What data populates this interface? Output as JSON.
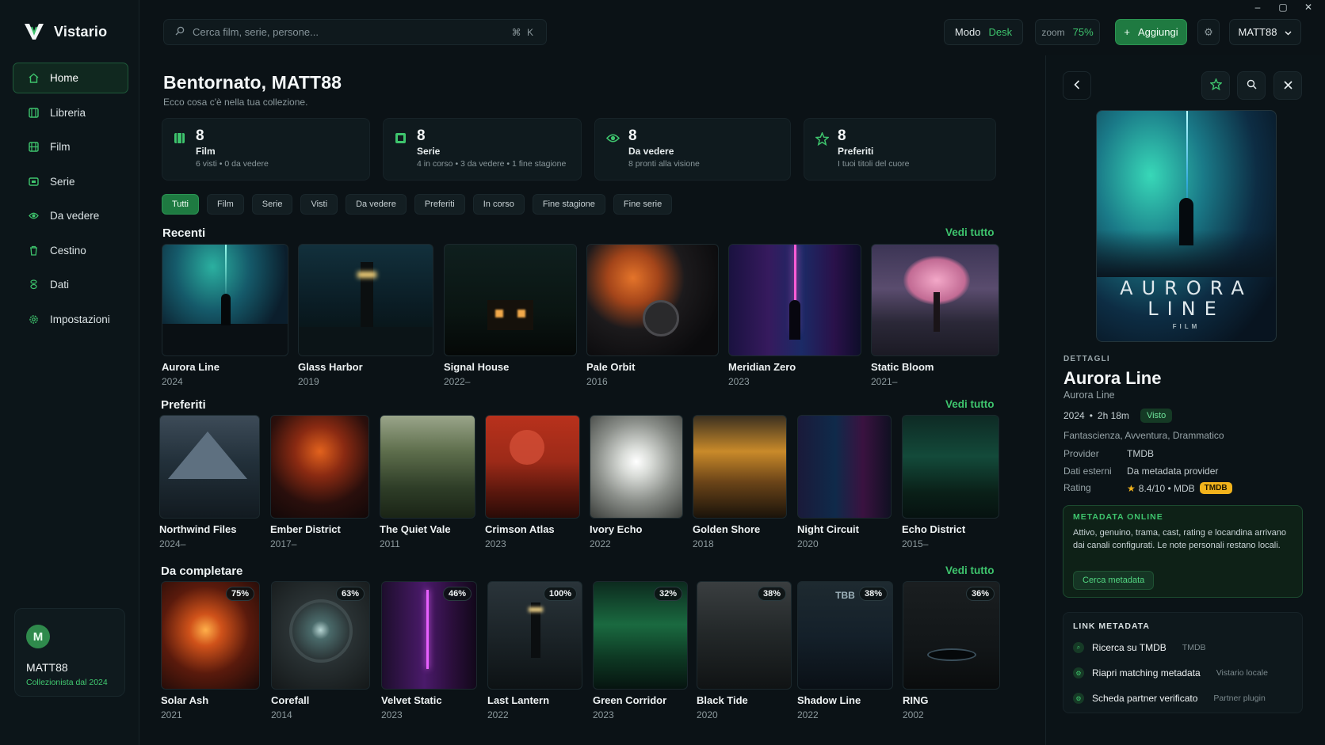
{
  "app": {
    "name": "Vistario"
  },
  "window": {
    "minimize": "–",
    "maximize": "▢",
    "close": "✕"
  },
  "sidebar": {
    "items": [
      {
        "label": "Home",
        "icon": "home-icon"
      },
      {
        "label": "Libreria",
        "icon": "library-icon"
      },
      {
        "label": "Film",
        "icon": "film-icon"
      },
      {
        "label": "Serie",
        "icon": "tv-icon"
      },
      {
        "label": "Da vedere",
        "icon": "eye-icon"
      },
      {
        "label": "Cestino",
        "icon": "trash-icon"
      },
      {
        "label": "Dati",
        "icon": "data-icon"
      },
      {
        "label": "Impostazioni",
        "icon": "gear-icon"
      }
    ],
    "active": "Home",
    "user": {
      "initial": "M",
      "name": "MATT88",
      "since": "Collezionista dal 2024"
    }
  },
  "topbar": {
    "search_placeholder": "Cerca film, serie, persone...",
    "search_shortcut": "⌘ K",
    "mode_label": "Modo",
    "mode_value": "Desk",
    "zoom_label": "zoom",
    "zoom_value": "75%",
    "add_label": "Aggiungi",
    "user_label": "MATT88"
  },
  "welcome": {
    "title": "Bentornato, MATT88",
    "subtitle": "Ecco cosa c'è nella tua collezione."
  },
  "stats": [
    {
      "num": "8",
      "label": "Film",
      "sub": "6 visti  •  0 da vedere",
      "icon": "film-icon"
    },
    {
      "num": "8",
      "label": "Serie",
      "sub": "4 in corso  •  3 da vedere  •  1 fine stagione",
      "icon": "tv-icon"
    },
    {
      "num": "8",
      "label": "Da vedere",
      "sub": "8 pronti alla visione",
      "icon": "eye-icon"
    },
    {
      "num": "8",
      "label": "Preferiti",
      "sub": "I tuoi titoli del cuore",
      "icon": "star-icon"
    }
  ],
  "filters": [
    "Tutti",
    "Film",
    "Serie",
    "Visti",
    "Da vedere",
    "Preferiti",
    "In corso",
    "Fine stagione",
    "Fine serie"
  ],
  "active_filter": "Tutti",
  "see_all": "Vedi tutto",
  "sections": {
    "recent": {
      "title": "Recenti",
      "items": [
        {
          "title": "Aurora Line",
          "year": "2024"
        },
        {
          "title": "Glass Harbor",
          "year": "2019"
        },
        {
          "title": "Signal House",
          "year": "2022–"
        },
        {
          "title": "Pale Orbit",
          "year": "2016"
        },
        {
          "title": "Meridian Zero",
          "year": "2023"
        },
        {
          "title": "Static Bloom",
          "year": "2021–"
        }
      ]
    },
    "favorites": {
      "title": "Preferiti",
      "items": [
        {
          "title": "Northwind Files",
          "year": "2024–"
        },
        {
          "title": "Ember District",
          "year": "2017–"
        },
        {
          "title": "The Quiet Vale",
          "year": "2011"
        },
        {
          "title": "Crimson Atlas",
          "year": "2023"
        },
        {
          "title": "Ivory Echo",
          "year": "2022"
        },
        {
          "title": "Golden Shore",
          "year": "2018"
        },
        {
          "title": "Night Circuit",
          "year": "2020"
        },
        {
          "title": "Echo District",
          "year": "2015–"
        }
      ]
    },
    "tocomplete": {
      "title": "Da completare",
      "items": [
        {
          "title": "Solar Ash",
          "year": "2021",
          "progress": "75%"
        },
        {
          "title": "Corefall",
          "year": "2014",
          "progress": "63%"
        },
        {
          "title": "Velvet Static",
          "year": "2023",
          "progress": "46%"
        },
        {
          "title": "Last Lantern",
          "year": "2022",
          "progress": "100%"
        },
        {
          "title": "Green Corridor",
          "year": "2023",
          "progress": "32%"
        },
        {
          "title": "Black Tide",
          "year": "2020",
          "progress": "38%"
        },
        {
          "title": "Shadow Line",
          "year": "2022",
          "progress": "38%",
          "poster_text": "TBB"
        },
        {
          "title": "RING",
          "year": "2002",
          "progress": "36%"
        }
      ]
    }
  },
  "detail": {
    "poster_title_1": "AURORA",
    "poster_title_2": "LINE",
    "poster_tag": "FILM",
    "section_label": "DETTAGLI",
    "title": "Aurora Line",
    "original_title": "Aurora Line",
    "year": "2024",
    "duration": "2h 18m",
    "status": "Visto",
    "genres": "Fantascienza, Avventura, Drammatico",
    "rows": [
      {
        "k": "Provider",
        "v": "TMDB"
      },
      {
        "k": "Dati esterni",
        "v": "Da metadata provider"
      }
    ],
    "rating_label": "Rating",
    "rating_value": "8.4/10  •  MDB",
    "rating_badge": "TMDB",
    "meta_box": {
      "title": "METADATA ONLINE",
      "desc": "Attivo, genuino, trama, cast, rating e locandina arrivano dai canali configurati. Le note personali restano locali.",
      "button": "Cerca metadata"
    },
    "links": {
      "title": "LINK METADATA",
      "items": [
        {
          "label": "Ricerca su TMDB",
          "tag": "TMDB"
        },
        {
          "label": "Riapri matching metadata",
          "tag": "Vistario locale"
        },
        {
          "label": "Scheda partner verificato",
          "tag": "Partner plugin"
        }
      ]
    }
  },
  "colors": {
    "accent": "#3ec46d",
    "bg": "#0b1216",
    "panel": "#0f1a1e",
    "badge": "#f2b31c"
  }
}
